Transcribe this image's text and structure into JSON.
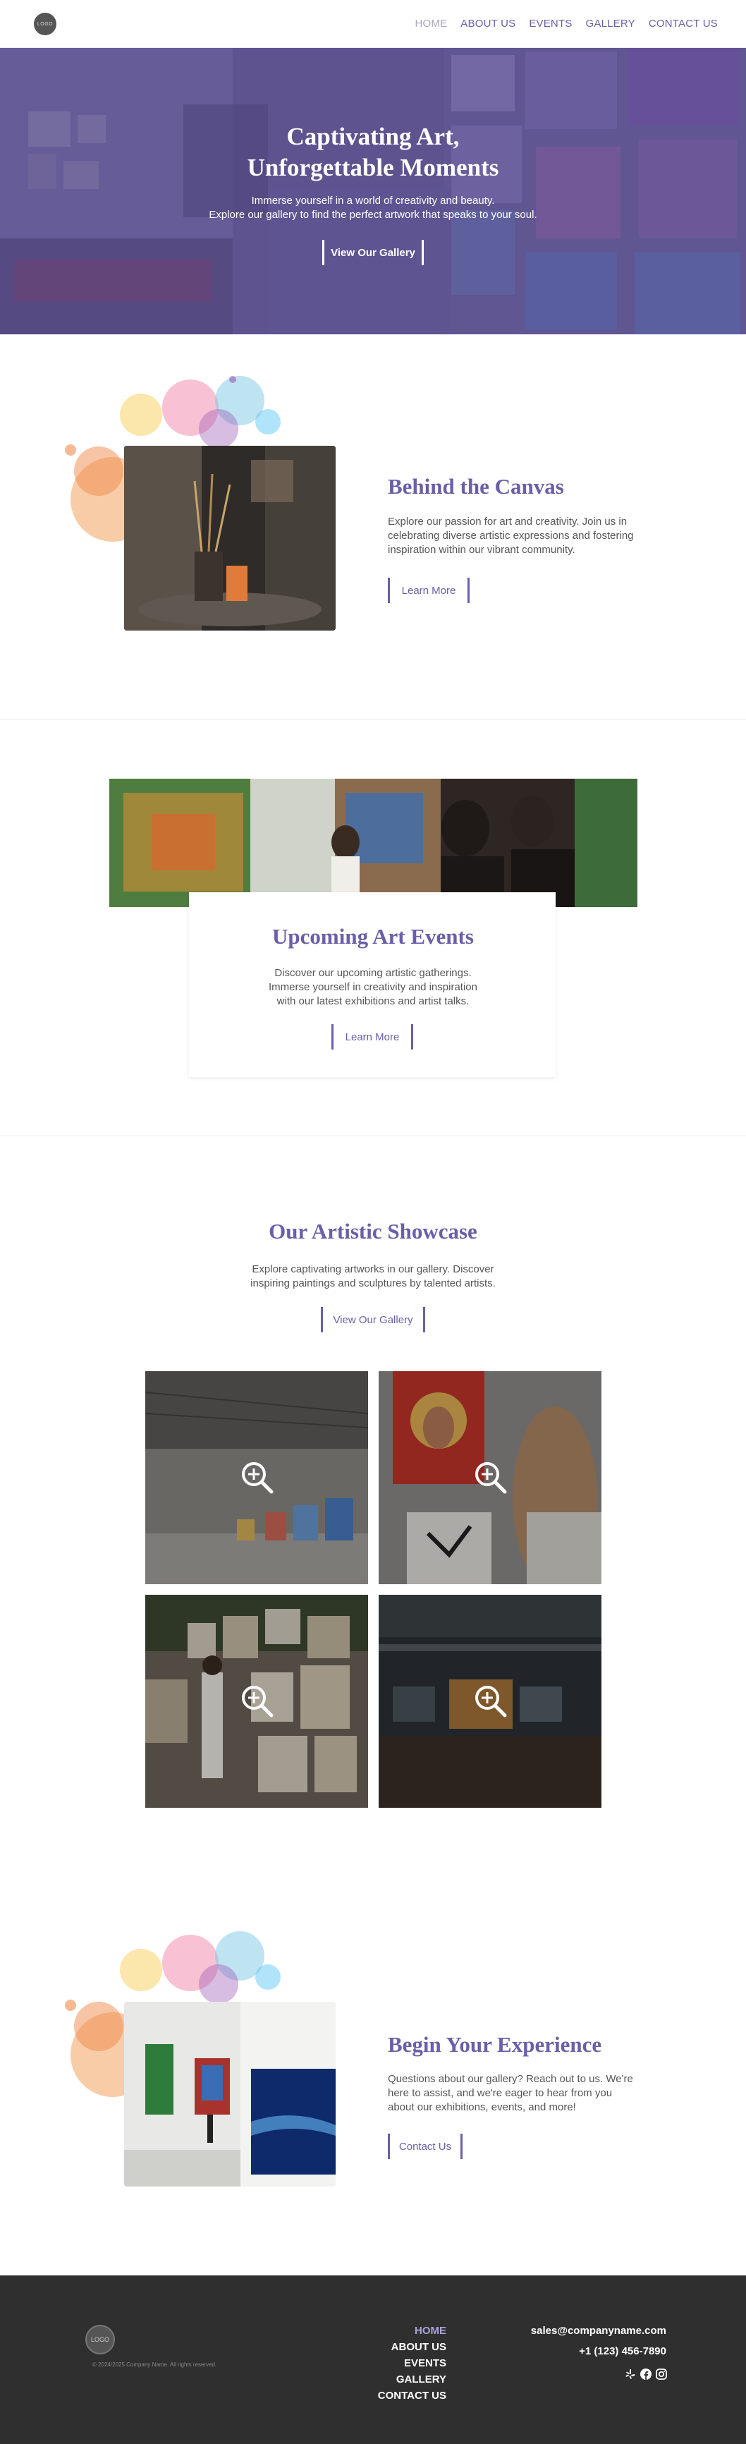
{
  "header": {
    "logo": "LOGO",
    "nav": [
      "HOME",
      "ABOUT US",
      "EVENTS",
      "GALLERY",
      "CONTACT US"
    ],
    "active": "HOME"
  },
  "hero": {
    "title_line1": "Captivating Art,",
    "title_line2": "Unforgettable Moments",
    "subtitle_line1": "Immerse yourself in a world of creativity and beauty.",
    "subtitle_line2": "Explore our gallery to find the perfect artwork that speaks to your soul.",
    "button": "View Our Gallery"
  },
  "about": {
    "title": "Behind the Canvas",
    "text_line1": "Explore our passion for art and creativity. Join us in",
    "text_line2": "celebrating diverse artistic expressions and fostering",
    "text_line3": "inspiration within our vibrant community.",
    "button": "Learn More"
  },
  "events": {
    "title": "Upcoming Art Events",
    "text_line1": "Discover our upcoming artistic gatherings.",
    "text_line2": "Immerse yourself in creativity and inspiration",
    "text_line3": "with our latest exhibitions and artist talks.",
    "button": "Learn More"
  },
  "showcase": {
    "title": "Our Artistic Showcase",
    "text_line1": "Explore captivating artworks in our gallery. Discover",
    "text_line2": "inspiring paintings and sculptures by talented artists.",
    "button": "View Our Gallery"
  },
  "contact": {
    "title": "Begin Your Experience",
    "text_line1": "Questions about our gallery? Reach out to us. We're",
    "text_line2": "here to assist, and we're eager to hear from you",
    "text_line3": "about our exhibitions, events, and more!",
    "button": "Contact Us"
  },
  "footer": {
    "logo": "LOGO",
    "copyright": "© 2024/2025 Company Name. All rights reserved.",
    "nav": [
      "HOME",
      "ABOUT US",
      "EVENTS",
      "GALLERY",
      "CONTACT US"
    ],
    "email": "sales@companyname.com",
    "phone": "+1 (123) 456-7890",
    "social_icons": [
      "yelp-icon",
      "facebook-icon",
      "instagram-icon"
    ]
  },
  "colors": {
    "accent": "#6a5fa8",
    "footer_bg": "#2f2f2f"
  }
}
